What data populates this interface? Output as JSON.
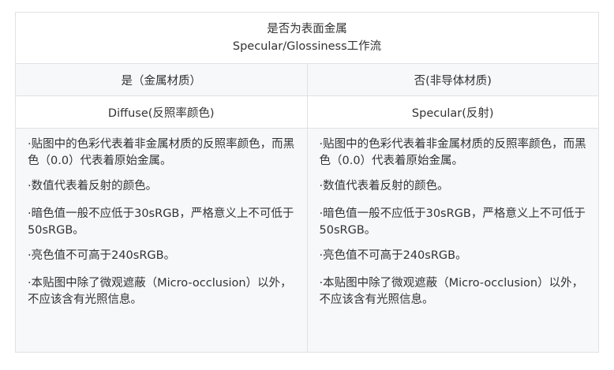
{
  "table": {
    "title_line1": "是否为表面金属",
    "title_line2": "Specular/Glossiness工作流",
    "col_left_header": "是（金属材质）",
    "col_right_header": "否(非导体材质)",
    "col_left_sub": "Diffuse(反照率颜色)",
    "col_right_sub": "Specular(反射)",
    "left_notes": [
      "·贴图中的色彩代表着非金属材质的反照率颜色，而黑色（0.0）代表着原始金属。",
      "·数值代表着反射的颜色。",
      "·暗色值一般不应低于30sRGB，严格意义上不可低于50sRGB。",
      "·亮色值不可高于240sRGB。",
      "·本贴图中除了微观遮蔽（Micro-occlusion）以外，不应该含有光照信息。"
    ],
    "right_notes": [
      "·贴图中的色彩代表着非金属材质的反照率颜色，而黑色（0.0）代表着原始金属。",
      "·数值代表着反射的颜色。",
      "·暗色值一般不应低于30sRGB，严格意义上不可低于50sRGB。",
      "·亮色值不可高于240sRGB。",
      "·本贴图中除了微观遮蔽（Micro-occlusion）以外，不应该含有光照信息。"
    ]
  }
}
